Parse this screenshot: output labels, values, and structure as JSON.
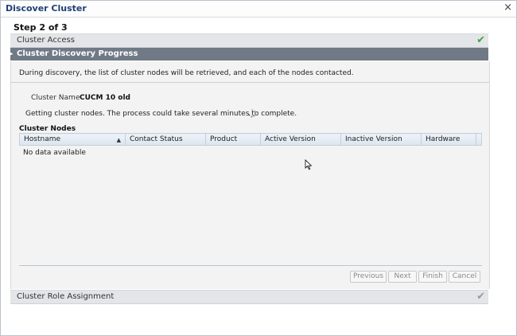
{
  "dialog": {
    "title": "Discover Cluster",
    "close_glyph": "×"
  },
  "wizard": {
    "step_label": "Step 2 of 3"
  },
  "sections": {
    "access": {
      "label": "Cluster Access",
      "status_icon": "check-icon",
      "status_color": "#3ca63c"
    },
    "progress": {
      "label": "Cluster Discovery Progress",
      "expanded": true
    },
    "role": {
      "label": "Cluster Role Assignment",
      "status_icon": "check-icon",
      "status_color": "#9a9a9a"
    }
  },
  "discovery": {
    "description": "During discovery, the list of cluster nodes will be retrieved, and each of the nodes contacted.",
    "cluster_name_label": "Cluster Name",
    "cluster_name_value": "CUCM 10 old",
    "status_message": "Getting cluster nodes. The process could take several minutes to complete."
  },
  "nodes": {
    "title": "Cluster Nodes",
    "columns": [
      "Hostname",
      "Contact Status",
      "Product",
      "Active Version",
      "Inactive Version",
      "Hardware"
    ],
    "sort_column": "Hostname",
    "sort_direction": "ascending",
    "rows": [],
    "empty_message": "No data available"
  },
  "buttons": {
    "previous": "Previous",
    "next": "Next",
    "finish": "Finish",
    "cancel": "Cancel"
  }
}
